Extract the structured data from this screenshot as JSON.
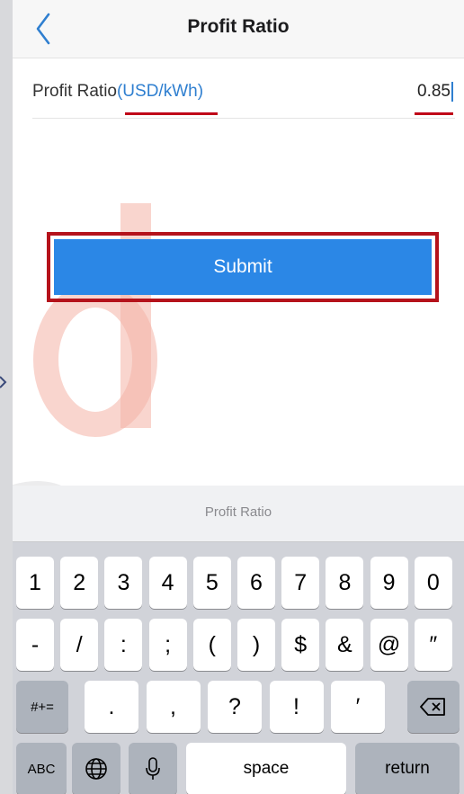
{
  "header": {
    "title": "Profit Ratio",
    "back_icon": "chevron-left-icon"
  },
  "field": {
    "label": "Profit Ratio",
    "unit": "(USD/kWh)",
    "value": "0.85"
  },
  "actions": {
    "submit_label": "Submit"
  },
  "keyboard": {
    "suggestion": "Profit Ratio",
    "row1": [
      "1",
      "2",
      "3",
      "4",
      "5",
      "6",
      "7",
      "8",
      "9",
      "0"
    ],
    "row2": [
      "-",
      "/",
      ":",
      ";",
      "(",
      ")",
      "$",
      "&",
      "@",
      "″"
    ],
    "row3_left": "#+=",
    "row3": [
      ".",
      ",",
      "?",
      "!",
      "′"
    ],
    "row4_abc": "ABC",
    "row4_space": "space",
    "row4_return": "return"
  },
  "colors": {
    "accent": "#2b87e6",
    "link": "#2f7fd0",
    "highlight": "#b5121b",
    "watermark": "#f4b3a6"
  }
}
